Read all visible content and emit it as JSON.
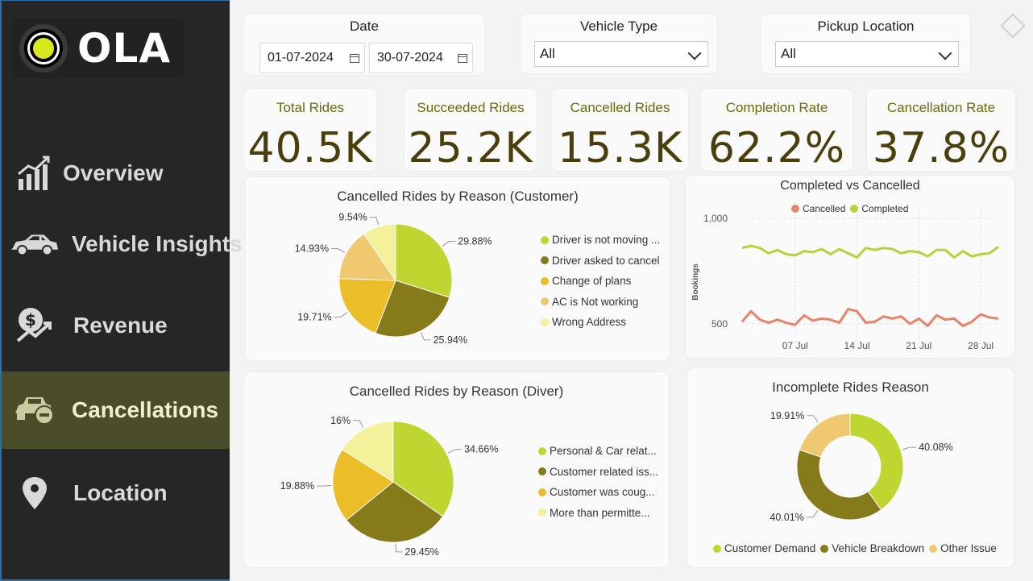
{
  "brand": {
    "name": "OLA"
  },
  "sidebar": {
    "items": [
      {
        "label": "Overview",
        "icon": "bar-chart-growth-icon"
      },
      {
        "label": "Vehicle Insights",
        "icon": "car-icon"
      },
      {
        "label": "Revenue",
        "icon": "dollar-growth-icon"
      },
      {
        "label": "Cancellations",
        "icon": "car-cancel-icon",
        "active": true
      },
      {
        "label": "Location",
        "icon": "location-pin-icon"
      }
    ]
  },
  "filters": {
    "date": {
      "title": "Date",
      "start": "01-07-2024",
      "end": "30-07-2024"
    },
    "vehicle_type": {
      "title": "Vehicle Type",
      "value": "All"
    },
    "pickup_location": {
      "title": "Pickup Location",
      "value": "All"
    }
  },
  "kpis": [
    {
      "title": "Total Rides",
      "value": "40.5K"
    },
    {
      "title": "Succeeded Rides",
      "value": "25.2K"
    },
    {
      "title": "Cancelled Rides",
      "value": "15.3K"
    },
    {
      "title": "Completion Rate",
      "value": "62.2%"
    },
    {
      "title": "Cancellation Rate",
      "value": "37.8%"
    }
  ],
  "colors": {
    "lime": "#bfd630",
    "olive": "#857b1a",
    "gold": "#ebbd27",
    "tan": "#f0c870",
    "pale": "#f3f29a",
    "cancelled": "#e8836a",
    "completed": "#b4d33a"
  },
  "chart_data": [
    {
      "type": "pie",
      "title": "Cancelled Rides by Reason (Customer)",
      "labels": [
        "Driver is not moving ...",
        "Driver asked to cancel",
        "Change of plans",
        "AC is Not working",
        "Wrong Address"
      ],
      "values": [
        29.88,
        25.94,
        19.71,
        14.93,
        9.54
      ],
      "value_labels": [
        "29.88%",
        "25.94%",
        "19.71%",
        "14.93%",
        "9.54%"
      ]
    },
    {
      "type": "pie",
      "title": "Cancelled Rides by Reason (Diver)",
      "labels": [
        "Personal & Car relat...",
        "Customer related iss...",
        "Customer was coug...",
        "More than permitte..."
      ],
      "values": [
        34.66,
        29.45,
        19.88,
        16.0
      ],
      "value_labels": [
        "34.66%",
        "29.45%",
        "19.88%",
        "16%"
      ]
    },
    {
      "type": "line",
      "title": "Completed vs Cancelled",
      "ylabel": "Bookings",
      "ylim": [
        400,
        1050
      ],
      "yticks": [
        "1,000",
        "500"
      ],
      "yticks_values": [
        1000,
        500
      ],
      "xticks": [
        "07 Jul",
        "14 Jul",
        "21 Jul",
        "28 Jul"
      ],
      "xticks_values": [
        7,
        14,
        21,
        28
      ],
      "x": [
        1,
        2,
        3,
        4,
        5,
        6,
        7,
        8,
        9,
        10,
        11,
        12,
        13,
        14,
        15,
        16,
        17,
        18,
        19,
        20,
        21,
        22,
        23,
        24,
        25,
        26,
        27,
        28,
        29,
        30
      ],
      "series": [
        {
          "name": "Cancelled",
          "values": [
            510,
            560,
            520,
            505,
            520,
            505,
            495,
            540,
            515,
            525,
            520,
            505,
            570,
            560,
            505,
            510,
            535,
            525,
            535,
            500,
            525,
            490,
            540,
            520,
            525,
            490,
            510,
            545,
            530,
            525
          ]
        },
        {
          "name": "Completed",
          "values": [
            860,
            870,
            860,
            835,
            850,
            830,
            825,
            845,
            840,
            855,
            830,
            855,
            835,
            815,
            860,
            850,
            860,
            855,
            835,
            845,
            840,
            820,
            850,
            850,
            815,
            845,
            820,
            830,
            835,
            865
          ]
        }
      ]
    },
    {
      "type": "donut",
      "title": "Incomplete Rides Reason",
      "labels": [
        "Customer Demand",
        "Vehicle Breakdown",
        "Other Issue"
      ],
      "values": [
        40.08,
        40.01,
        19.91
      ],
      "value_labels": [
        "40.08%",
        "40.01%",
        "19.91%"
      ]
    }
  ]
}
